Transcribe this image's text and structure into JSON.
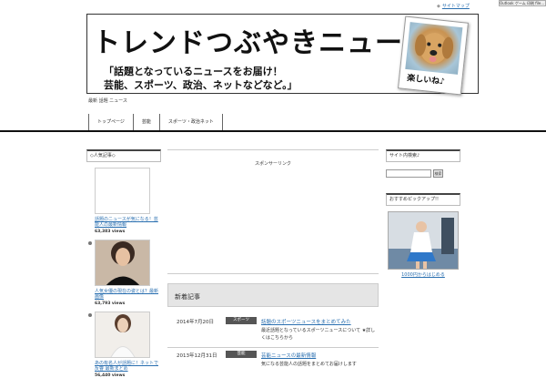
{
  "topbar": {
    "widget_label": "Outlook ゲーム 印刷 file...",
    "link": "サイトマップ"
  },
  "banner": {
    "title": "トレンドつぶやきニュース",
    "tagline_1": "「話題となっているニュースをお届け！",
    "tagline_2": "芸能、スポーツ、政治、ネットなどなど。」",
    "photo_caption": "楽しいね♪"
  },
  "site_desc": "最新 話題 ニュース",
  "nav": [
    "トップページ",
    "芸能",
    "スポーツ・政治ネット"
  ],
  "left_sidebar": {
    "heading": "◇人気記事◇",
    "items": [
      {
        "title": "話題のニュースが気になる！芸能人の最新情報",
        "views": "63,383 views"
      },
      {
        "title": "人気女優の現在の姿とは？最新画像",
        "views": "63,793 views"
      },
      {
        "title": "あの有名人が話題に！ネットで反響 最新まとめ",
        "views": "56,440 views"
      }
    ]
  },
  "main": {
    "top_text": "スポンサーリンク",
    "news_heading": "新着記事",
    "news": [
      {
        "date": "2014年7月20日",
        "category": "スポーツ",
        "title": "話題のスポーツニュースをまとめてみた",
        "excerpt": "最近話題となっているスポーツニュースについて ★詳しくはこちらから"
      },
      {
        "date": "2013年12月31日",
        "category": "芸能",
        "title": "芸能ニュースの最新情報",
        "excerpt": "気になる芸能人の話題をまとめてお届けします"
      }
    ]
  },
  "right_sidebar": {
    "heading_1": "サイト内検索♪",
    "search_button": "検索",
    "search_placeholder": "",
    "heading_2": "おすすめピックアップ!!",
    "ad_caption": "1000円からはじめる"
  }
}
